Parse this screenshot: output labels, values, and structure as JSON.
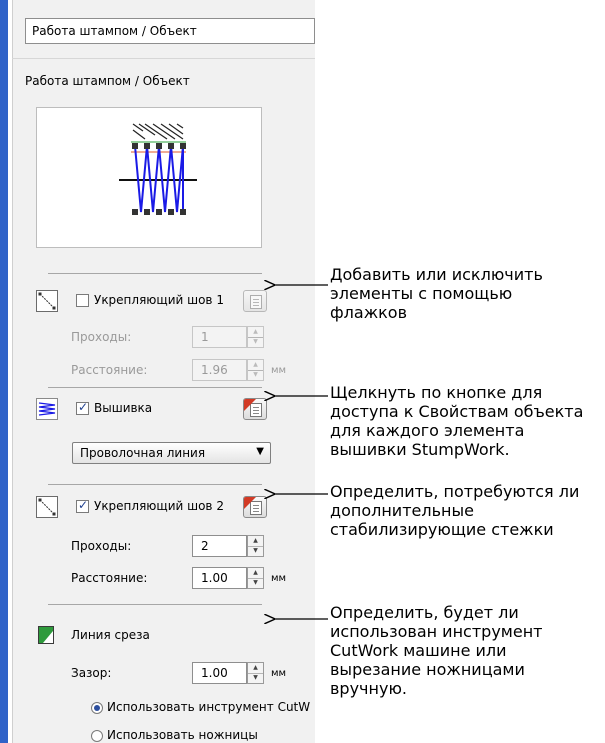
{
  "panel": {
    "header_combo": "Работа штампом / Объект",
    "section_title": "Работа штампом / Объект",
    "underlay1": {
      "label": "Укрепляющий шов 1",
      "checked": false,
      "enabled": false,
      "passes_label": "Проходы:",
      "passes_value": "1",
      "spacing_label": "Расстояние:",
      "spacing_value": "1.96",
      "unit": "мм"
    },
    "embroidery": {
      "label": "Вышивка",
      "checked": true,
      "style_value": "Проволочная линия"
    },
    "underlay2": {
      "label": "Укрепляющий шов 2",
      "checked": true,
      "passes_label": "Проходы:",
      "passes_value": "2",
      "spacing_label": "Расстояние:",
      "spacing_value": "1.00",
      "unit": "мм"
    },
    "cutline": {
      "label": "Линия среза",
      "gap_label": "Зазор:",
      "gap_value": "1.00",
      "unit": "мм",
      "option_tool": "Использовать инструмент CutW",
      "option_scissors": "Использовать ножницы",
      "selected": "tool"
    }
  },
  "callouts": {
    "c1": [
      "Добавить или исключить",
      "элементы с помощью",
      "флажков"
    ],
    "c2": [
      "Щелкнуть по кнопке для",
      "доступа к Свойствам объекта",
      "для каждого элемента",
      "вышивки StumpWork."
    ],
    "c3": [
      "Определить, потребуются ли",
      "дополнительные",
      "стабилизирующие стежки"
    ],
    "c4": [
      "Определить, будет ли",
      "использован инструмент",
      "CutWork машине или",
      "вырезание ножницами",
      "вручную."
    ]
  },
  "colors": {
    "accent_stripe": "#2f62c8",
    "stitch_blue": "#1a1ae6",
    "property_flag": "#d23a25",
    "cutline_icon": "#2e9a3c"
  }
}
